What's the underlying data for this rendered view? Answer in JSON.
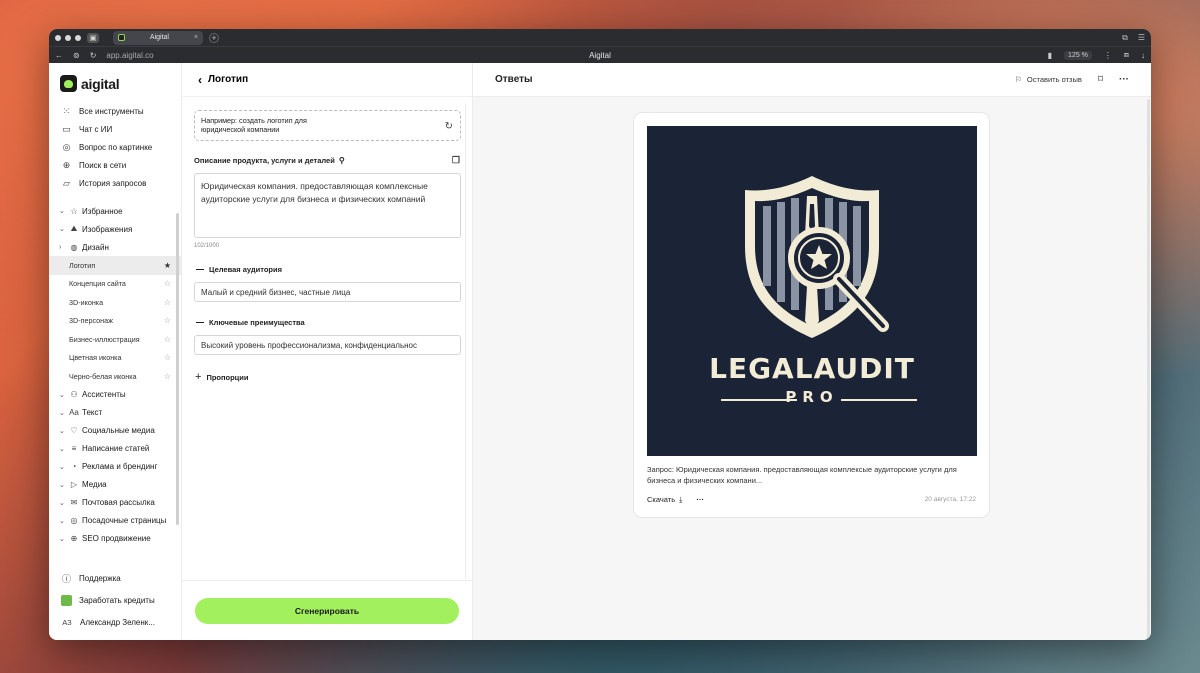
{
  "browser": {
    "tab_title": "Aigital",
    "url": "app.aigital.co",
    "window_title": "Aigital",
    "zoom": "125 %"
  },
  "sidebar": {
    "brand": "aigital",
    "main_items": [
      {
        "icon": "grid-icon",
        "label": "Все инструменты"
      },
      {
        "icon": "chat-icon",
        "label": "Чат с ИИ"
      },
      {
        "icon": "eye-icon",
        "label": "Вопрос по картинке"
      },
      {
        "icon": "globe-icon",
        "label": "Поиск в сети"
      },
      {
        "icon": "folder-icon",
        "label": "История запросов"
      }
    ],
    "categories_top": [
      {
        "label": "Избранное",
        "icon": "star-icon"
      },
      {
        "label": "Изображения",
        "icon": "image-icon"
      },
      {
        "label": "Дизайн",
        "icon": "design-icon"
      }
    ],
    "design_items": [
      {
        "label": "Логотип",
        "active": true
      },
      {
        "label": "Концепция сайта"
      },
      {
        "label": "3D-иконка"
      },
      {
        "label": "3D-персонаж"
      },
      {
        "label": "Бизнес-иллюстрация"
      },
      {
        "label": "Цветная иконка"
      },
      {
        "label": "Черно-белая иконка"
      }
    ],
    "categories_bottom": [
      {
        "label": "Ассистенты",
        "icon": "assistant-icon",
        "icon_text": "⚇"
      },
      {
        "label": "Текст",
        "icon": "text-icon",
        "icon_text": "Aa"
      },
      {
        "label": "Социальные медиа",
        "icon": "heart-icon",
        "icon_text": "♡"
      },
      {
        "label": "Написание статей",
        "icon": "lines-icon",
        "icon_text": "≡"
      },
      {
        "label": "Реклама и брендинг",
        "icon": "megaphone-icon",
        "icon_text": "◔"
      },
      {
        "label": "Медиа",
        "icon": "media-icon",
        "icon_text": "▷"
      },
      {
        "label": "Почтовая рассылка",
        "icon": "mail-icon",
        "icon_text": "✉"
      },
      {
        "label": "Посадочные страницы",
        "icon": "landing-icon",
        "icon_text": "◎"
      },
      {
        "label": "SEO продвижение",
        "icon": "seo-icon",
        "icon_text": "⊕"
      }
    ],
    "support": "Поддержка",
    "earn": "Заработать кредиты",
    "user_initials": "АЗ",
    "user_name": "Александр Зеленк..."
  },
  "form": {
    "back_title": "Логотип",
    "example_text": "Например: создать логотип для юридической компании",
    "description_label": "Описание продукта, услуги и деталей",
    "description_value": "Юридическая компания. предоставляющая комплексные аудиторские услуги для бизнеса и физических компаний",
    "counter": "102/1000",
    "audience_label": "Целевая аудитория",
    "audience_value": "Малый и средний бизнес, частные лица",
    "advantages_label": "Ключевые преимущества",
    "advantages_value": "Высокий уровень профессионализма, конфиденциальнос",
    "proportions_label": "Пропорции",
    "generate_label": "Сгенерировать"
  },
  "results": {
    "title": "Ответы",
    "feedback_label": "Оставить отзыв",
    "card": {
      "image_title": "LEGALAUDIT",
      "image_subtitle": "PRO",
      "prompt": "Запрос: Юридическая компания. предоставляющая комплексые аудиторские услуги для бизнеса и физических компани...",
      "download_label": "Скачать",
      "date": "20 августа, 17:22"
    }
  },
  "colors": {
    "accent_green": "#a3f05e",
    "logo_bg": "#1b2436",
    "logo_cream": "#f2ecd6"
  }
}
